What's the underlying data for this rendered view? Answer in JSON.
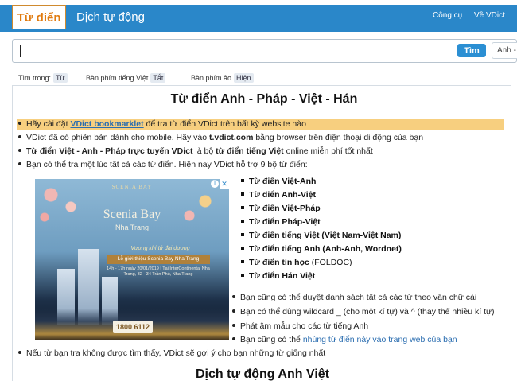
{
  "header": {
    "tab_dictionary": "Từ điển",
    "tab_auto_translate": "Dịch tự động",
    "nav_tools": "Công cụ",
    "nav_about": "Về VDict"
  },
  "search": {
    "value": "",
    "button_label": "Tìm",
    "language_selected": "Anh - Việt"
  },
  "options": {
    "lookup_in_label": "Tìm trong:",
    "lookup_in_value": "Từ",
    "vn_keyboard_label": "Bàn phím tiếng Việt",
    "vn_keyboard_value": "Tắt",
    "virtual_keyboard_label": "Bàn phím ảo",
    "virtual_keyboard_value": "Hiện"
  },
  "main": {
    "title": "Từ điển Anh - Pháp - Việt - Hán",
    "line1_pre": "Hãy cài đặt ",
    "line1_link": "VDict bookmarklet",
    "line1_post": " để tra từ điển VDict trên bất kỳ website nào",
    "line2_pre": "VDict đã có phiên bản dành cho mobile. Hãy vào ",
    "line2_bold": "t.vdict.com",
    "line2_post": " bằng browser trên điện thoại di động của bạn",
    "line3_bold": "Từ điển Việt - Anh - Pháp trực tuyến VDict",
    "line3_mid": " là bộ ",
    "line3_bold2": "từ điển tiếng Việt",
    "line3_post": " online miễn phí tốt nhất",
    "line4": "Bạn có thể tra một lúc tất cả các từ điển. Hiện nay VDict hỗ trợ 9 bộ từ điển:",
    "dictionaries": [
      "Từ điển Việt-Anh",
      "Từ điển Anh-Việt",
      "Từ điển Việt-Pháp",
      "Từ điển Pháp-Việt",
      "Từ điển tiếng Việt (Việt Nam-Việt Nam)",
      "Từ điển tiếng Anh (Anh-Anh, Wordnet)",
      "Từ điển tin học",
      "Từ điển Hán Việt"
    ],
    "foldoc": " (FOLDOC)",
    "tip1": "Bạn cũng có thể duyệt danh sách tất cả các từ theo vần chữ cái",
    "tip2": "Bạn có thể dùng wildcard _ (cho một kí tự) và ^ (thay thế nhiều kí tự)",
    "tip3": "Phát âm mẫu cho các từ tiếng Anh",
    "tip4_pre": "Bạn cũng có thể ",
    "tip4_link": "nhúng từ điển này vào trang web của bạn",
    "line_notfound": "Nếu từ bạn tra không được tìm thấy, VDict sẽ gợi ý cho bạn những từ giống nhất",
    "section2_title": "Dịch tự động Anh Việt"
  },
  "ad": {
    "logo_text": "SCENIA BAY",
    "title": "Scenia Bay",
    "subtitle": "Nha Trang",
    "tagline": "Vương khí tứ đại dương",
    "event": "Lễ giới thiệu Scenia Bay Nha Trang",
    "detail": "14h - 17h ngày 20/01/2019 | Tại InterContinental Nha Trang, 32 - 34 Trần Phú, Nha Trang",
    "phone": "1800 6112",
    "info_icon": "i",
    "close_icon": "✕"
  }
}
